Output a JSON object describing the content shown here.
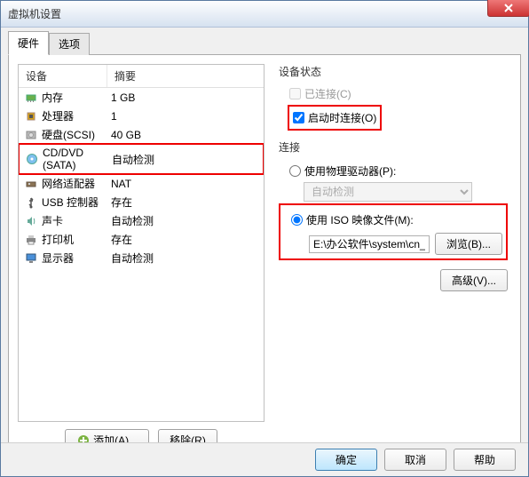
{
  "window": {
    "title": "虚拟机设置"
  },
  "tabs": {
    "hardware": "硬件",
    "options": "选项"
  },
  "device_header": {
    "name": "设备",
    "summary": "摘要"
  },
  "devices": [
    {
      "icon": "memory-icon",
      "name": "内存",
      "summary": "1 GB"
    },
    {
      "icon": "cpu-icon",
      "name": "处理器",
      "summary": "1"
    },
    {
      "icon": "disk-icon",
      "name": "硬盘(SCSI)",
      "summary": "40 GB"
    },
    {
      "icon": "cd-icon",
      "name": "CD/DVD (SATA)",
      "summary": "自动检测",
      "highlight": true
    },
    {
      "icon": "network-icon",
      "name": "网络适配器",
      "summary": "NAT"
    },
    {
      "icon": "usb-icon",
      "name": "USB 控制器",
      "summary": "存在"
    },
    {
      "icon": "sound-icon",
      "name": "声卡",
      "summary": "自动检测"
    },
    {
      "icon": "printer-icon",
      "name": "打印机",
      "summary": "存在"
    },
    {
      "icon": "display-icon",
      "name": "显示器",
      "summary": "自动检测"
    }
  ],
  "list_buttons": {
    "add": "添加(A)...",
    "remove": "移除(R)"
  },
  "status": {
    "label": "设备状态",
    "connected": "已连接(C)",
    "connect_on_power": "启动时连接(O)"
  },
  "connection": {
    "label": "连接",
    "physical": "使用物理驱动器(P):",
    "physical_value": "自动检测",
    "iso": "使用 ISO 映像文件(M):",
    "iso_value": "E:\\办公软件\\system\\cn_win",
    "browse": "浏览(B)..."
  },
  "advanced": "高级(V)...",
  "footer": {
    "ok": "确定",
    "cancel": "取消",
    "help": "帮助"
  }
}
